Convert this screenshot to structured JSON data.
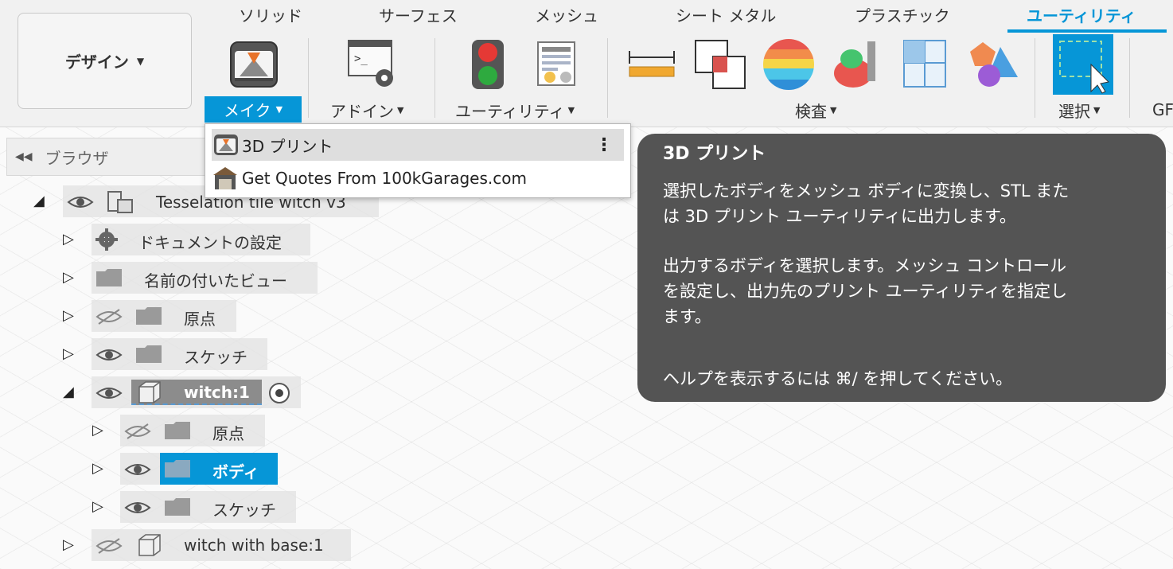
{
  "workspace": {
    "label": "デザイン"
  },
  "tabs": [
    "ソリッド",
    "サーフェス",
    "メッシュ",
    "シート メタル",
    "プラスチック",
    "ユーティリティ"
  ],
  "groups": {
    "make": "メイク",
    "addins": "アドイン",
    "utility": "ユーティリティ",
    "inspect": "検査",
    "select": "選択",
    "gf": "GF"
  },
  "browser": {
    "title": "ブラウザ",
    "tree": [
      {
        "label": "Tesselation tile witch v3"
      },
      {
        "label": "ドキュメントの設定"
      },
      {
        "label": "名前の付いたビュー"
      },
      {
        "label": "原点"
      },
      {
        "label": "スケッチ"
      },
      {
        "label": "witch:1"
      },
      {
        "label": "原点"
      },
      {
        "label": "ボディ"
      },
      {
        "label": "スケッチ"
      },
      {
        "label": "witch with base:1"
      }
    ]
  },
  "dropdown": {
    "items": [
      "3D プリント",
      "Get Quotes From 100kGarages.com"
    ]
  },
  "tooltip": {
    "title": "3D プリント",
    "p1_line1": "選択したボディをメッシュ ボディに変換し、STL また",
    "p1_line2": "は 3D プリント ユーティリティに出力します。",
    "p2_line1": "出力するボディを選択します。メッシュ コントロール",
    "p2_line2": "を設定し、出力先のプリント ユーティリティを指定し",
    "p2_line3": "ます。",
    "p3": "ヘルプを表示するには ⌘/ を押してください。"
  },
  "colors": {
    "accent": "#0696d7",
    "tooltip_bg": "#545454"
  }
}
